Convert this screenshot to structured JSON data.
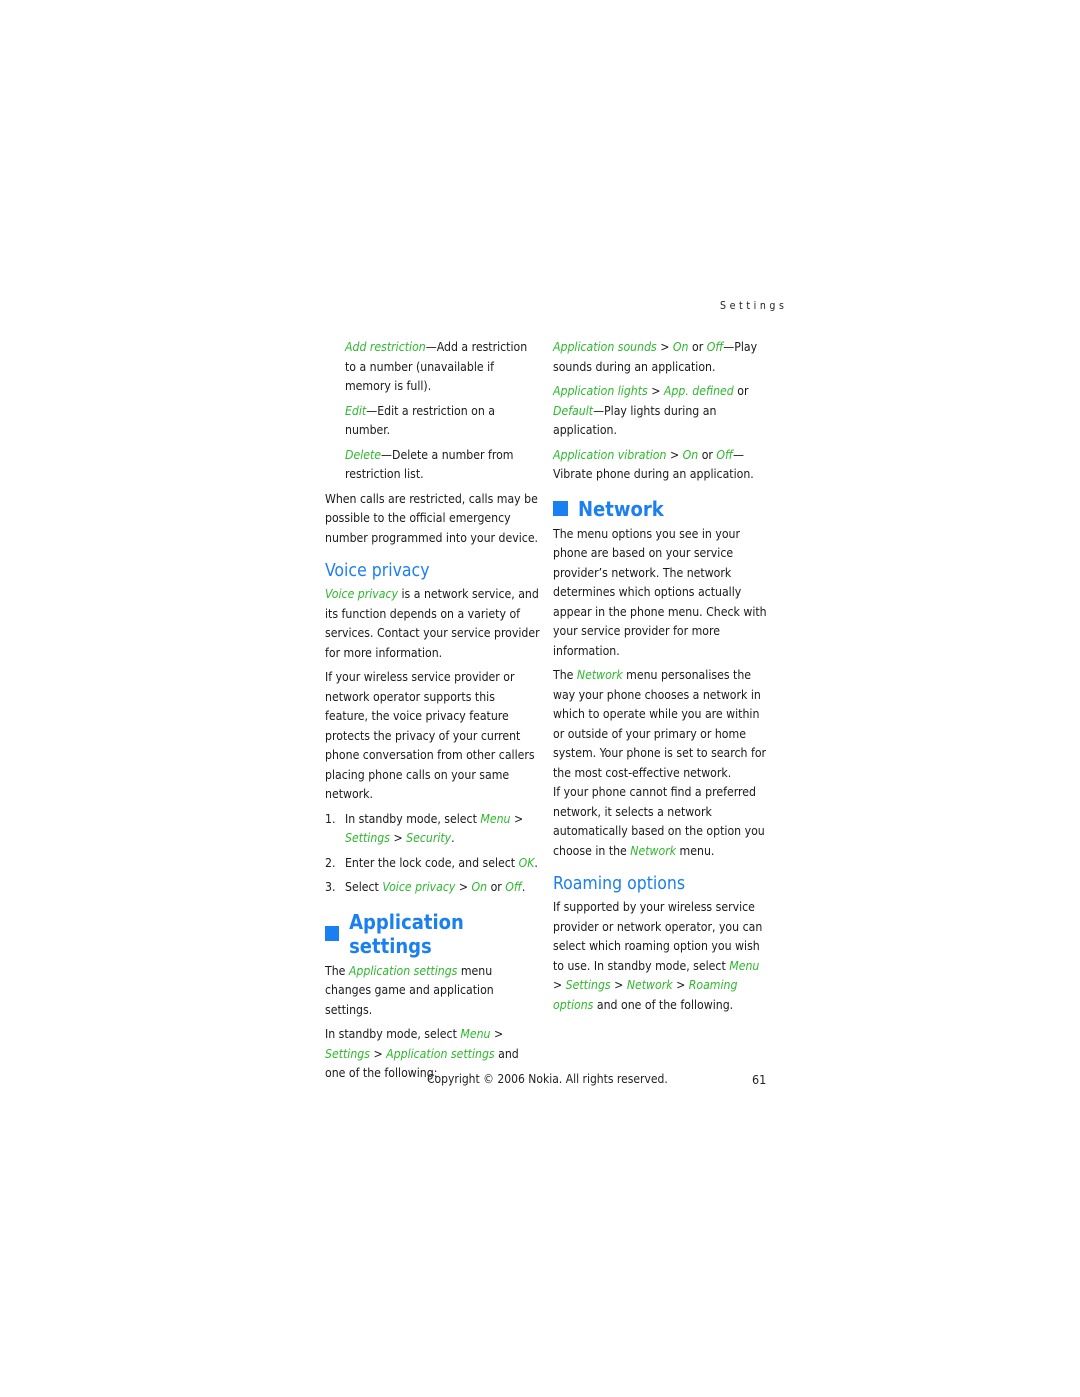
{
  "running_head": "Settings",
  "left_column": {
    "restriction_options": [
      {
        "term": "Add restriction",
        "desc": "—Add a restriction to a number (unavailable if memory is full)."
      },
      {
        "term": "Edit",
        "desc": "—Edit a restriction on a number."
      },
      {
        "term": "Delete",
        "desc": "—Delete a number from restriction list."
      }
    ],
    "restriction_note": "When calls are restricted, calls may be possible to the official emergency number programmed into your device.",
    "voice_privacy": {
      "heading": "Voice privacy",
      "intro_term": "Voice privacy",
      "intro_rest": " is a network service, and its function depends on a variety of services. Contact your service provider for more information.",
      "para2": "If your wireless service provider or network operator supports this feature, the voice privacy feature protects the privacy of your current phone conversation from other callers placing phone calls on your same network.",
      "steps": [
        {
          "num": "1.",
          "pre": "In standby mode, select ",
          "t1": "Menu",
          "sep1": " > ",
          "t2": "Settings",
          "sep2": " > ",
          "t3": "Security",
          "post": "."
        },
        {
          "num": "2.",
          "pre": "Enter the lock code, and select ",
          "t1": "OK",
          "post": "."
        },
        {
          "num": "3.",
          "pre": "Select ",
          "t1": "Voice privacy",
          "sep1": " > ",
          "t2": "On",
          "sep2": " or ",
          "t3": "Off",
          "post": "."
        }
      ]
    },
    "application_settings": {
      "heading": "Application settings",
      "p1_pre": "The ",
      "p1_term": "Application settings",
      "p1_post": " menu changes game and application settings.",
      "p2_pre": "In standby mode, select ",
      "p2_t1": "Menu",
      "p2_sep1": " > ",
      "p2_t2": "Settings",
      "p2_sep2": " > ",
      "p2_t3": "Application settings",
      "p2_post": " and one of the following:"
    }
  },
  "right_column": {
    "app_options": [
      {
        "t1": "Application sounds",
        "s1": " > ",
        "t2": "On",
        "s2": " or ",
        "t3": "Off",
        "desc": "—Play sounds during an application."
      },
      {
        "t1": "Application lights",
        "s1": " > ",
        "t2": "App. defined",
        "s2": " or ",
        "t3": "Default",
        "desc": "—Play lights during an application."
      },
      {
        "t1": "Application vibration",
        "s1": " > ",
        "t2": "On",
        "s2": " or ",
        "t3": "Off",
        "desc": "— Vibrate phone during an application."
      }
    ],
    "network": {
      "heading": "Network",
      "p1": "The menu options you see in your phone are based on your service provider’s network. The network determines which options actually appear in the phone menu. Check with your service provider for more information.",
      "p2_pre": "The ",
      "p2_term": "Network",
      "p2_post": " menu personalises the way your phone chooses a network in which to operate while you are within or outside of your primary or home system. Your phone is set to search for the most cost-effective network.",
      "p3_pre": "If your phone cannot find a preferred network, it selects a network automatically based on the option you choose in the ",
      "p3_term": "Network",
      "p3_post": " menu."
    },
    "roaming": {
      "heading": "Roaming options",
      "p_pre": "If supported by your wireless service provider or network operator, you can select which roaming option you wish to use. In standby mode, select ",
      "t1": "Menu",
      "s1": " > ",
      "t2": "Settings",
      "s2": " > ",
      "t3": "Network",
      "s3": " > ",
      "t4": "Roaming options",
      "p_post": " and one of the following."
    }
  },
  "footer": {
    "copyright": "Copyright © 2006 Nokia. All rights reserved.",
    "page_number": "61"
  }
}
